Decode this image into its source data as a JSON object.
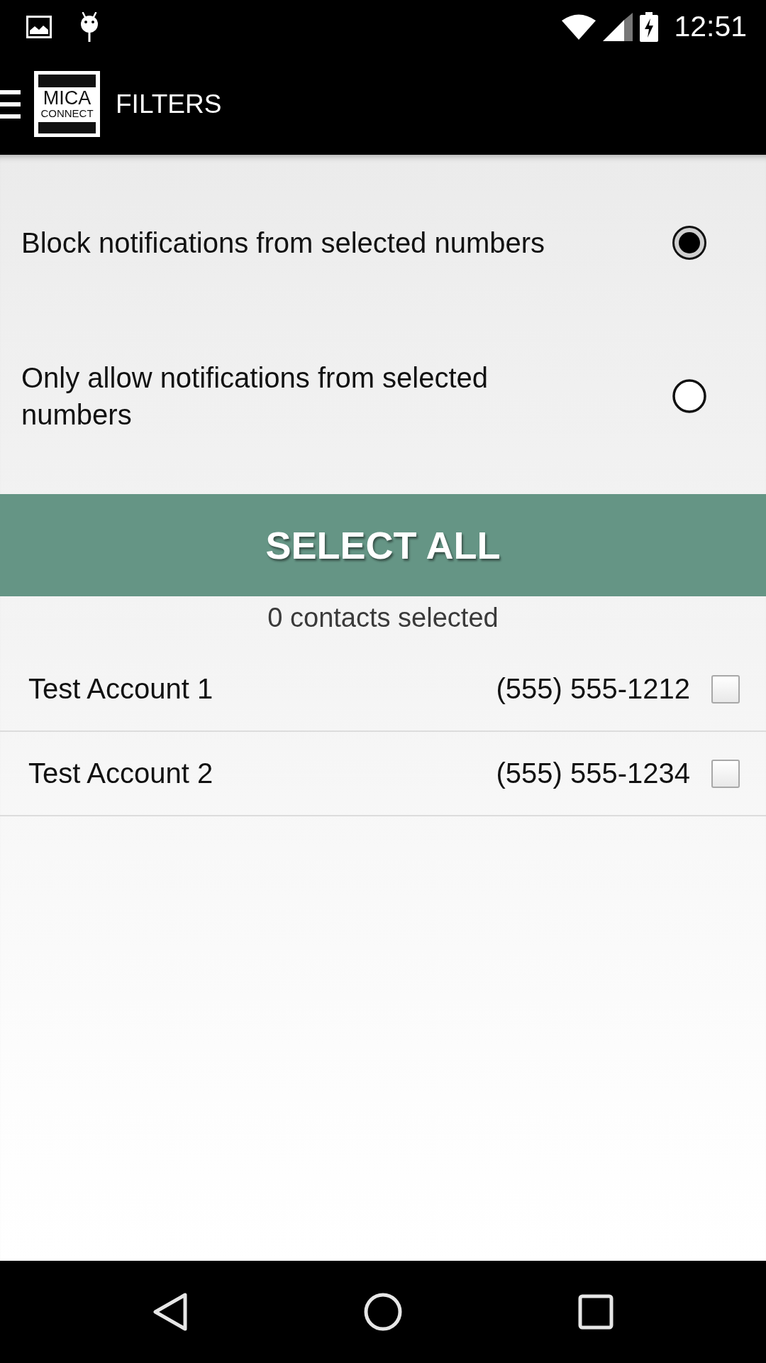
{
  "status_bar": {
    "time": "12:51"
  },
  "app_bar": {
    "logo": {
      "wordmark": "MICA",
      "tagline": "CONNECT"
    },
    "title": "FILTERS"
  },
  "filter_options": [
    {
      "label": "Block notifications from selected numbers",
      "selected": true
    },
    {
      "label": "Only allow notifications from selected numbers",
      "selected": false
    }
  ],
  "select_all_button": {
    "label": "SELECT ALL"
  },
  "selection_count": "0 contacts selected",
  "contacts": [
    {
      "name": "Test Account 1",
      "phone": "(555) 555-1212",
      "checked": false
    },
    {
      "name": "Test Account 2",
      "phone": "(555) 555-1234",
      "checked": false
    }
  ]
}
